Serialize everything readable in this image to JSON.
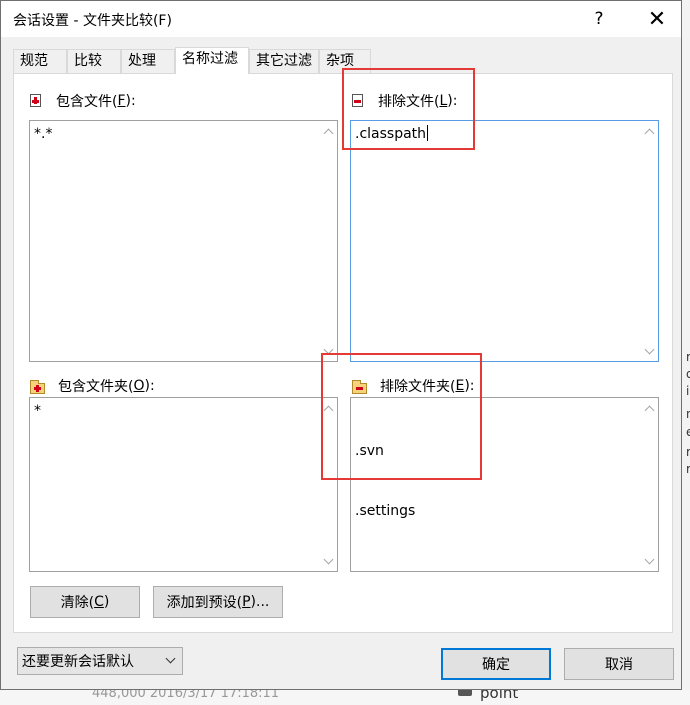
{
  "window": {
    "title": "会话设置 - 文件夹比较(F)",
    "help_glyph": "?",
    "close_glyph": "✕"
  },
  "tabs": [
    {
      "label": "规范",
      "active": false
    },
    {
      "label": "比较",
      "active": false
    },
    {
      "label": "处理",
      "active": false
    },
    {
      "label": "名称过滤",
      "active": true
    },
    {
      "label": "其它过滤",
      "active": false
    },
    {
      "label": "杂项",
      "active": false
    }
  ],
  "include_files": {
    "label_pre": "包含文件(",
    "label_key": "F",
    "label_post": "):",
    "value": "*.*",
    "icon": "file-include-icon"
  },
  "exclude_files": {
    "label_pre": "排除文件(",
    "label_key": "L",
    "label_post": "):",
    "value": ".classpath",
    "icon": "file-exclude-icon"
  },
  "include_folders": {
    "label_pre": "包含文件夹(",
    "label_key": "O",
    "label_post": "):",
    "value": "*",
    "icon": "folder-include-icon"
  },
  "exclude_folders": {
    "label_pre": "排除文件夹(",
    "label_key": "E",
    "label_post": "):",
    "values": [
      ".svn",
      ".settings"
    ],
    "icon": "folder-exclude-icon"
  },
  "buttons": {
    "clear_pre": "清除(",
    "clear_key": "C",
    "clear_post": ")",
    "preset_pre": "添加到预设(",
    "preset_key": "P",
    "preset_post": ")...",
    "ok": "确定",
    "cancel": "取消"
  },
  "session_dropdown": {
    "selected": "还要更新会话默认"
  },
  "background": {
    "bottom_text": "448,000 2016/3/17 17:18:11",
    "bottom_right_text": "point",
    "right_chars": [
      "r",
      "o",
      "i",
      "n",
      "e",
      "r",
      "r"
    ]
  },
  "colors": {
    "highlight": "#e53935",
    "focus_border": "#569de5",
    "default_button_border": "#0078d7"
  }
}
